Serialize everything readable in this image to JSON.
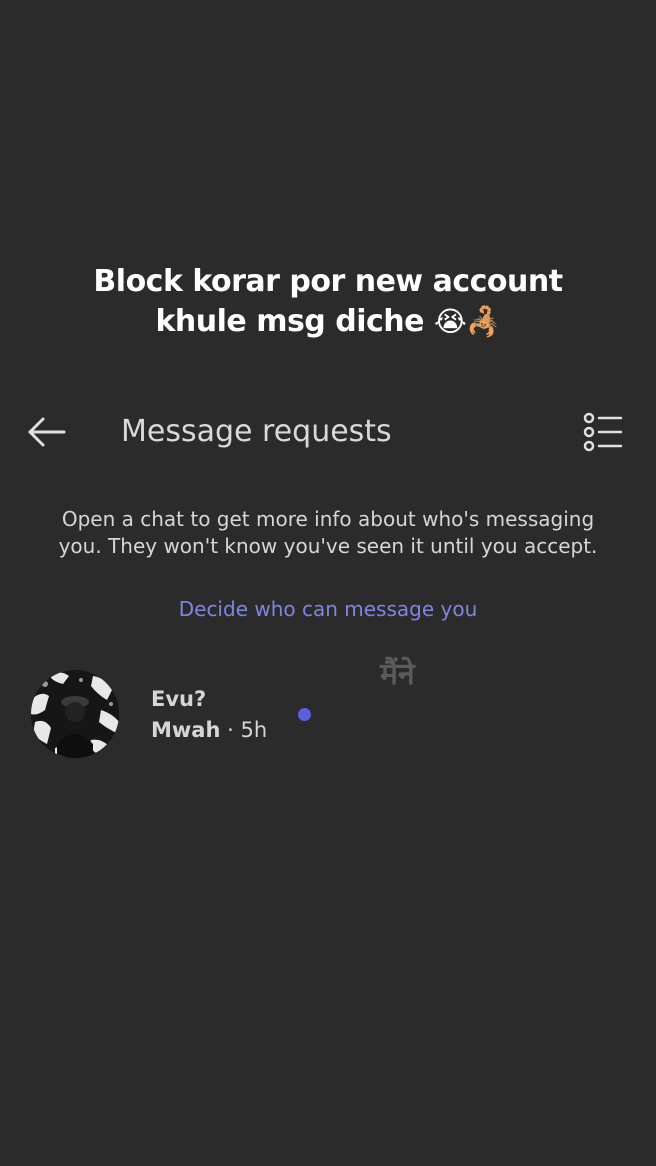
{
  "caption": {
    "line1": "Block korar por new account",
    "line2": "khule msg diche",
    "emoji": "😭🦂"
  },
  "header": {
    "title": "Message requests",
    "back_icon": "arrow-left-icon",
    "filter_icon": "list-filter-icon"
  },
  "info": {
    "text": "Open a chat to get more info about who's messaging you. They won't know you've seen it until you accept.",
    "link": "Decide who can message you"
  },
  "watermark": "मैंने",
  "requests": [
    {
      "name": "Evu?",
      "message": "Mwah",
      "separator": " · ",
      "time": "5h",
      "unread": true
    }
  ],
  "colors": {
    "background": "#2b2b2b",
    "link": "#7f86e0",
    "unread_dot": "#5b5fe0"
  }
}
